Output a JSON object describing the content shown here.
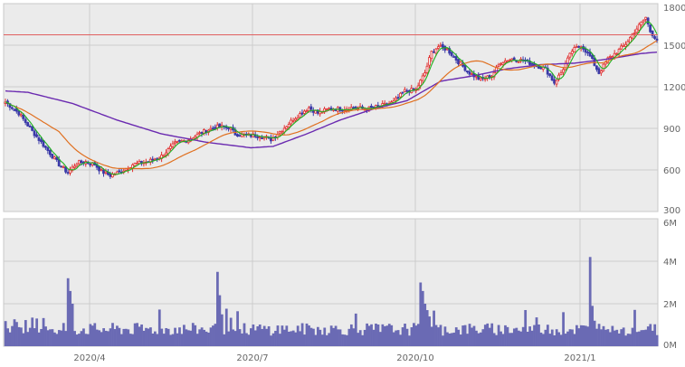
{
  "chart_data": [
    {
      "type": "candlestick",
      "title": "",
      "ylim": [
        300,
        1800
      ],
      "y_ticks": [
        "1800",
        "1500",
        "1200",
        "900",
        "600",
        "300"
      ],
      "x_ticks": [
        "2020/4",
        "2020/7",
        "2020/10",
        "2021/1"
      ],
      "reference_line": {
        "value": 1575,
        "color": "#e06060"
      },
      "grid": true,
      "colors": {
        "up": "#e03030",
        "down": "#3a3aa8",
        "ma_short": "#20b020",
        "ma_mid": "#e07020",
        "ma_long": "#6a2ab0"
      },
      "close_anchors": [
        [
          0,
          1090
        ],
        [
          6,
          1010
        ],
        [
          12,
          880
        ],
        [
          18,
          760
        ],
        [
          24,
          640
        ],
        [
          28,
          580
        ],
        [
          32,
          650
        ],
        [
          36,
          660
        ],
        [
          40,
          640
        ],
        [
          43,
          590
        ],
        [
          47,
          560
        ],
        [
          52,
          590
        ],
        [
          57,
          640
        ],
        [
          64,
          660
        ],
        [
          70,
          700
        ],
        [
          76,
          790
        ],
        [
          82,
          820
        ],
        [
          88,
          870
        ],
        [
          94,
          910
        ],
        [
          100,
          910
        ],
        [
          103,
          860
        ],
        [
          108,
          850
        ],
        [
          114,
          850
        ],
        [
          119,
          820
        ],
        [
          124,
          890
        ],
        [
          130,
          980
        ],
        [
          136,
          1050
        ],
        [
          140,
          1010
        ],
        [
          145,
          1040
        ],
        [
          150,
          1040
        ],
        [
          156,
          1050
        ],
        [
          162,
          1040
        ],
        [
          168,
          1060
        ],
        [
          174,
          1090
        ],
        [
          179,
          1170
        ],
        [
          184,
          1180
        ],
        [
          188,
          1300
        ],
        [
          191,
          1450
        ],
        [
          194,
          1490
        ],
        [
          198,
          1470
        ],
        [
          203,
          1380
        ],
        [
          208,
          1300
        ],
        [
          213,
          1250
        ],
        [
          218,
          1280
        ],
        [
          222,
          1380
        ],
        [
          227,
          1400
        ],
        [
          232,
          1390
        ],
        [
          237,
          1360
        ],
        [
          242,
          1330
        ],
        [
          246,
          1230
        ],
        [
          249,
          1300
        ],
        [
          254,
          1460
        ],
        [
          258,
          1500
        ],
        [
          262,
          1420
        ],
        [
          266,
          1300
        ],
        [
          270,
          1400
        ],
        [
          274,
          1450
        ],
        [
          278,
          1510
        ],
        [
          282,
          1600
        ],
        [
          285,
          1660
        ],
        [
          287,
          1700
        ],
        [
          289,
          1600
        ],
        [
          291,
          1560
        ],
        [
          292,
          1540
        ]
      ],
      "ma_long_anchors": [
        [
          0,
          1170
        ],
        [
          10,
          1160
        ],
        [
          30,
          1080
        ],
        [
          50,
          960
        ],
        [
          70,
          860
        ],
        [
          90,
          800
        ],
        [
          110,
          760
        ],
        [
          120,
          770
        ],
        [
          135,
          860
        ],
        [
          150,
          960
        ],
        [
          165,
          1040
        ],
        [
          180,
          1100
        ],
        [
          195,
          1240
        ],
        [
          210,
          1280
        ],
        [
          225,
          1330
        ],
        [
          240,
          1360
        ],
        [
          255,
          1370
        ],
        [
          270,
          1400
        ],
        [
          285,
          1440
        ],
        [
          292,
          1450
        ]
      ]
    },
    {
      "type": "bar",
      "title": "",
      "ylim": [
        0,
        6
      ],
      "y_ticks": [
        "6M",
        "4M",
        "2M",
        "0M"
      ],
      "x_ticks": [
        "2020/4",
        "2020/7",
        "2020/10",
        "2021/1"
      ],
      "color": "#6a6ab4",
      "unit": "M"
    }
  ]
}
